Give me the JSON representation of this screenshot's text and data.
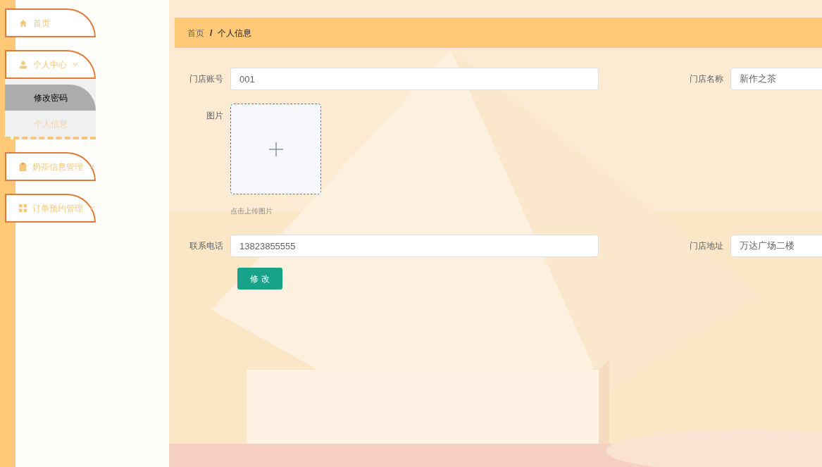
{
  "sidebar": {
    "items": [
      {
        "kind": "link",
        "label": "首页"
      },
      {
        "kind": "submenu",
        "label": "个人中心",
        "children": [
          {
            "label": "修改密码",
            "highlighted": true
          },
          {
            "label": "个人信息",
            "highlighted": false
          }
        ]
      },
      {
        "kind": "submenu",
        "label": "奶茶信息管理"
      },
      {
        "kind": "submenu",
        "label": "订单预约管理"
      }
    ]
  },
  "breadcrumb": {
    "separator": "/",
    "items": [
      "首页",
      "个人信息"
    ]
  },
  "form": {
    "rows": [
      {
        "kind": "pair",
        "fields": [
          {
            "label": "门店账号",
            "value": "001"
          },
          {
            "label": "门店名称",
            "value": "新作之茶"
          }
        ]
      },
      {
        "kind": "upload",
        "label": "图片",
        "hint": "点击上传图片"
      },
      {
        "kind": "pair",
        "fields": [
          {
            "label": "联系电话",
            "value": "13823855555"
          },
          {
            "label": "门店地址",
            "value": "万达广场二楼"
          }
        ]
      }
    ],
    "submit": "修 改"
  }
}
